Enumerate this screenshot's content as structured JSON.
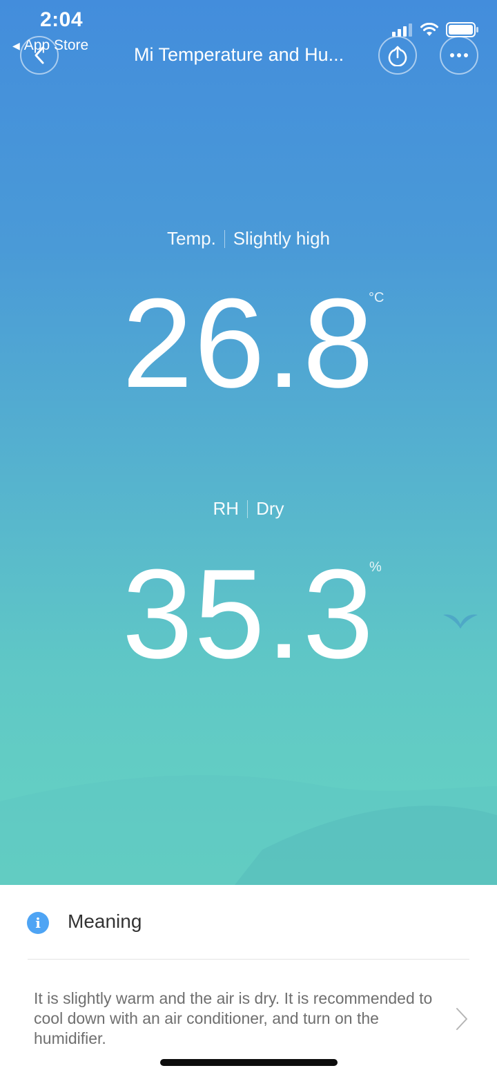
{
  "status_bar": {
    "time": "2:04",
    "back_app": "App Store",
    "icons": [
      "cellular-signal-icon",
      "wifi-icon",
      "battery-icon"
    ]
  },
  "nav": {
    "title": "Mi Temperature and Hu...",
    "back_icon": "chevron-left-icon",
    "share_icon": "share-upload-icon",
    "more_icon": "more-dots-icon"
  },
  "temperature": {
    "label": "Temp.",
    "status": "Slightly high",
    "value": "26.8",
    "unit": "°C"
  },
  "humidity": {
    "label": "RH",
    "status": "Dry",
    "value": "35.3",
    "unit": "%"
  },
  "meaning": {
    "title": "Meaning",
    "icon": "info-icon",
    "description": "It is slightly warm and the air is dry. It is recommended to cool down with an air conditioner, and turn on the humidifier."
  },
  "colors": {
    "gradient_top": "#438ddc",
    "gradient_bottom": "#66d3c2",
    "info_blue": "#4ea4f4"
  }
}
